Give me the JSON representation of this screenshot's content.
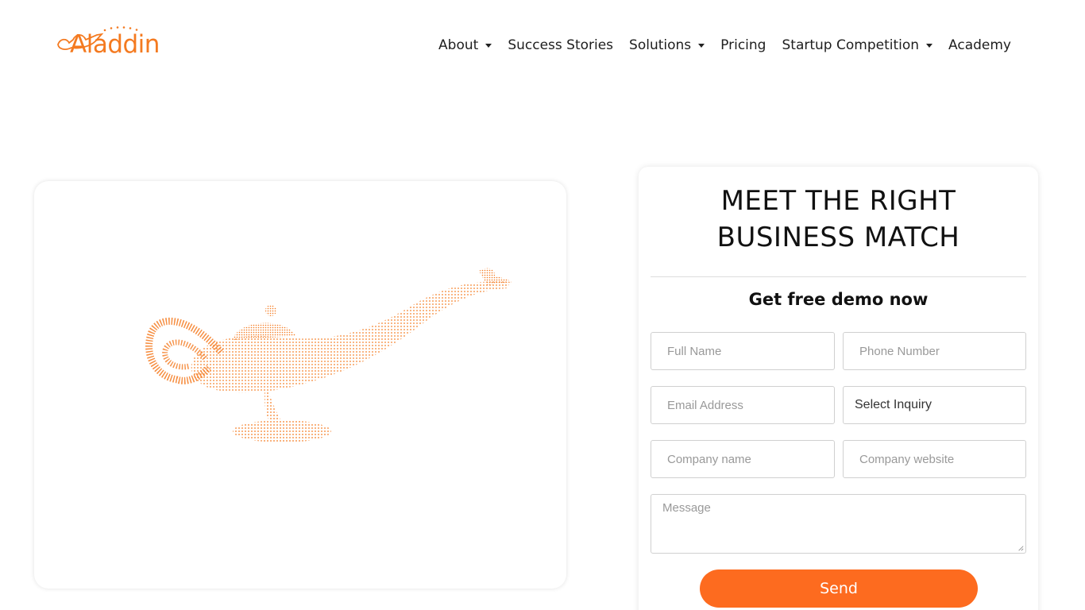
{
  "brand": {
    "name": "Aladdin",
    "color": "#f47a20"
  },
  "nav": {
    "items": [
      {
        "label": "About",
        "dropdown": true
      },
      {
        "label": "Success Stories",
        "dropdown": false
      },
      {
        "label": "Solutions",
        "dropdown": true
      },
      {
        "label": "Pricing",
        "dropdown": false
      },
      {
        "label": "Startup Competition",
        "dropdown": true
      },
      {
        "label": "Academy",
        "dropdown": false
      }
    ]
  },
  "hero": {
    "image_icon": "magic-lamp-icon"
  },
  "form": {
    "title_line1": "MEET THE RIGHT",
    "title_line2": "BUSINESS MATCH",
    "subtitle": "Get free demo now",
    "full_name_placeholder": "Full Name",
    "phone_placeholder": "Phone Number",
    "email_placeholder": "Email Address",
    "inquiry_selected": "Select Inquiry",
    "company_name_placeholder": "Company name",
    "company_website_placeholder": "Company website",
    "message_placeholder": "Message",
    "send_label": "Send",
    "accent_color": "#fd6b1f"
  }
}
